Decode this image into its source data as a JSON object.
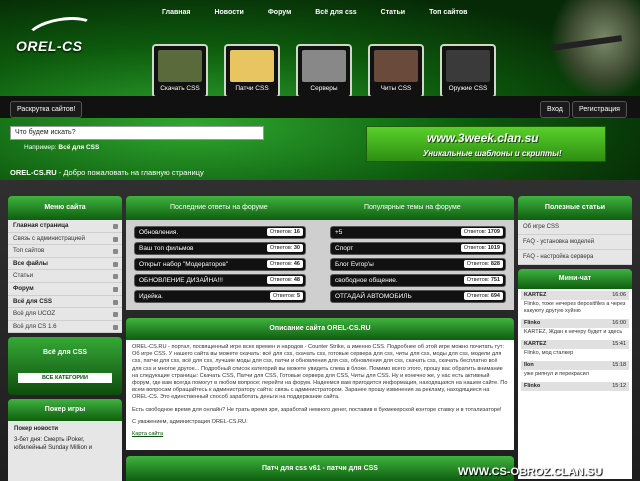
{
  "nav": [
    "Главная",
    "Новости",
    "Форум",
    "Всё для css",
    "Статьи",
    "Топ сайтов"
  ],
  "logo": "OREL-CS",
  "tiles": [
    {
      "label": "Скачать CSS",
      "color": "#5a6a3a"
    },
    {
      "label": "Патчи CSS",
      "color": "#e8c560"
    },
    {
      "label": "Серверы",
      "color": "#888888"
    },
    {
      "label": "Читы CSS",
      "color": "#6a4a3a"
    },
    {
      "label": "Оружие CSS",
      "color": "#3a3a3a"
    }
  ],
  "promote_button": "Раскрутка сайтов!",
  "login_button": "Вход",
  "register_button": "Регистрация",
  "search": {
    "placeholder": "Что будем искать?",
    "example_label": "Например:",
    "example_value": "Всё для CSS"
  },
  "banner": {
    "line1": "www.3week.clan.su",
    "line2": "Уникальные шаблоны и скрипты!"
  },
  "welcome": {
    "site": "OREL-CS.RU",
    "text": " - Добро пожаловать на главную страницу"
  },
  "menu": {
    "title": "Меню сайта",
    "items": [
      {
        "label": "Главная страница",
        "bold": true
      },
      {
        "label": "Связь с администрацией",
        "bold": false
      },
      {
        "label": "Топ сайтов",
        "bold": false
      },
      {
        "label": "Все файлы",
        "bold": true
      },
      {
        "label": "Статьи",
        "bold": false
      },
      {
        "label": "Форум",
        "bold": true
      },
      {
        "label": "Всё для CSS",
        "bold": true
      },
      {
        "label": "Всё для UCOZ",
        "bold": false
      },
      {
        "label": "Всё для CS 1.6",
        "bold": false
      }
    ]
  },
  "csbox": {
    "title": "Всё для CSS",
    "button": "ВСЕ КАТЕГОРИИ"
  },
  "poker": {
    "title": "Покер игры",
    "news_title": "Покер новости",
    "item": "3-бет дня: Смерть iPoker, юбилейный Sunday Million и"
  },
  "forum": {
    "recent_title": "Последние ответы на форуме",
    "popular_title": "Популярные темы на форуме",
    "replies_label": "Ответов:",
    "recent": [
      {
        "title": "Обновления.",
        "count": "16"
      },
      {
        "title": "Ваш топ фильмов",
        "count": "30"
      },
      {
        "title": "Открыт набор \"Модераторов\"",
        "count": "46"
      },
      {
        "title": "ОБНОВЛЕНИЕ ДИЗАЙНА!!!",
        "count": "48"
      },
      {
        "title": "Идейка.",
        "count": "5"
      }
    ],
    "popular": [
      {
        "title": "+5",
        "count": "1709"
      },
      {
        "title": "Спорт",
        "count": "1019"
      },
      {
        "title": "Блог Evrop'ы",
        "count": "828"
      },
      {
        "title": "свободное общение.",
        "count": "751"
      },
      {
        "title": "ОТГАДАЙ АВТОМОБИЛЬ",
        "count": "694"
      }
    ]
  },
  "description": {
    "title": "Описание сайта OREL-CS.RU",
    "p1": "OREL-CS.RU - портал, посвященный игре всех времен и народов - Counter Strike, а именно CSS. Подробнее об этой игре можно почитать тут: Об игре CSS. У нашего сайта вы можете скачать: всё для css, скачать css, готовые сервера для css, читы для css, моды для css, модели для css, патчи для css, всё для сss, лучшие моды для css, патчи и обновления для css, обновления для css, скачать css, скачать бесплатно всё для css и многое другое... Подробный список категорий вы можете увидеть слева в блоке. Помимо всего этого, прошу вас обратить внимание на следующие страницы: Скачать CSS, Патчи для CSS, Готовые сервера для CSS, Читы для CSS. Ну и конечно же, у нас есть активный форум, где вам всегда помогут в любом вопросе: перейти на форум. Надеемся вам пригодится информация, находящаяся на нашем сайте. По всем вопросам обращайтесь к администратору сайта: связь с администратором. Заранее прошу извинения за рекламу, находящиеся на OREL-CS. Это единственный способ заработать деньги на поддержание сайта.",
    "p2": "Есть свободное время для онлайн? Не трать время зря, заработай немного денег, поставив в букмекерской конторе ставку и в тотализаторе!",
    "p3": "С уважением, администрация OREL-CS.RU.",
    "p4": "Карта сайта"
  },
  "patches_title": "Патч для css v61 - патчи для CSS",
  "useful": {
    "title": "Полезные статьи",
    "items": [
      "Об игре CSS",
      "FAQ - установка моделей",
      "FAQ - настройка сервера"
    ]
  },
  "chat": {
    "title": "Мини-чат",
    "messages": [
      {
        "user": "KARTEZ",
        "time": "16:06",
        "text": "Flinko, тоже нечерез depositfiles а через какуюту другую хуйню"
      },
      {
        "user": "Flinko",
        "time": "16:00",
        "text": "KARTEZ, Ждан к нечеру будет и здесь"
      },
      {
        "user": "KARTEZ",
        "time": "15:41",
        "text": "Flinko, мод сталкер"
      },
      {
        "user": "Ilon",
        "time": "15:18",
        "text": "уже рипнул и перекрасил"
      },
      {
        "user": "Flinko",
        "time": "15:12",
        "text": ""
      }
    ]
  },
  "watermark": "WWW.CS-OBROZ.CLAN.SU"
}
